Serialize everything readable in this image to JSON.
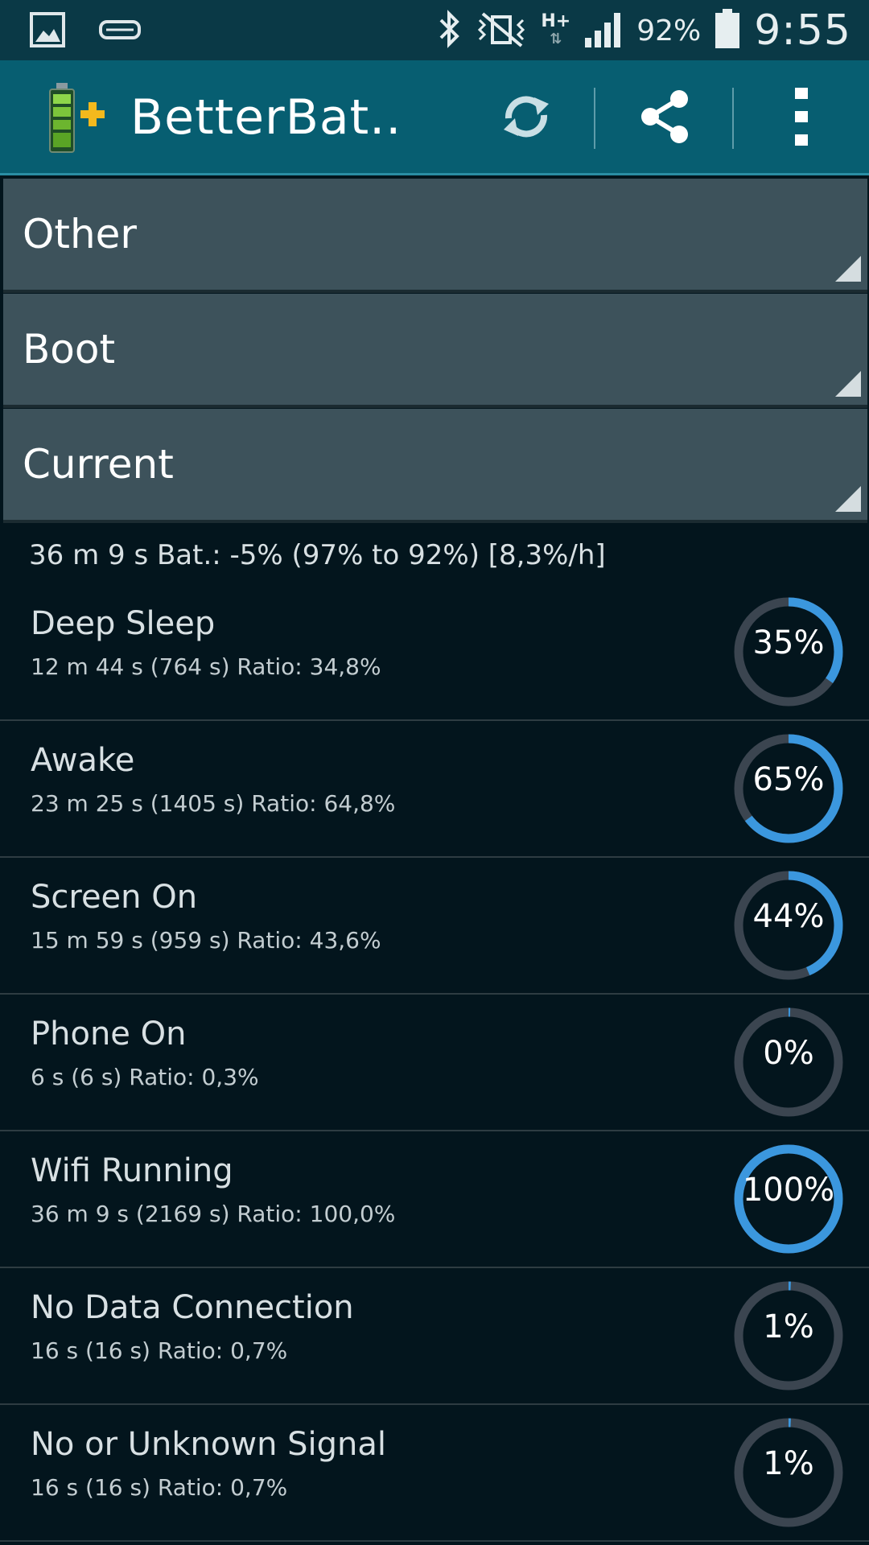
{
  "status_bar": {
    "left_icons": [
      "gallery-icon",
      "vr-headset-icon"
    ],
    "right_icons": [
      "bluetooth-icon",
      "vibrate-icon",
      "network-type-icon",
      "signal-icon",
      "battery-icon"
    ],
    "network_type": "H+",
    "battery_percent": "92%",
    "time": "9:55"
  },
  "action_bar": {
    "title": "BetterBat..",
    "icons": [
      "battery-plus-icon",
      "refresh-icon",
      "share-icon",
      "more-vert-icon"
    ],
    "accent": "#075e71"
  },
  "spinners": [
    {
      "label": "Other"
    },
    {
      "label": "Boot"
    },
    {
      "label": "Current"
    }
  ],
  "summary": "36 m 9 s  Bat.: -5% (97% to 92%) [8,3%/h]",
  "colors": {
    "ring_fill": "#3b97de",
    "ring_track": "#3b4550",
    "background": "#03151d"
  },
  "rows": [
    {
      "title": "Deep Sleep",
      "detail": "12 m 44 s  (764 s) Ratio: 34,8%",
      "percent_label": "35%",
      "ratio": 0.348
    },
    {
      "title": "Awake",
      "detail": "23 m 25 s  (1405 s) Ratio: 64,8%",
      "percent_label": "65%",
      "ratio": 0.648
    },
    {
      "title": "Screen On",
      "detail": "15 m 59 s  (959 s) Ratio: 43,6%",
      "percent_label": "44%",
      "ratio": 0.436
    },
    {
      "title": "Phone On",
      "detail": "6 s  (6 s) Ratio: 0,3%",
      "percent_label": "0%",
      "ratio": 0.003
    },
    {
      "title": "Wifi Running",
      "detail": "36 m 9 s  (2169 s) Ratio: 100,0%",
      "percent_label": "100%",
      "ratio": 1.0
    },
    {
      "title": "No Data Connection",
      "detail": "16 s  (16 s) Ratio: 0,7%",
      "percent_label": "1%",
      "ratio": 0.007
    },
    {
      "title": "No or Unknown Signal",
      "detail": "16 s  (16 s) Ratio: 0,7%",
      "percent_label": "1%",
      "ratio": 0.007
    }
  ]
}
